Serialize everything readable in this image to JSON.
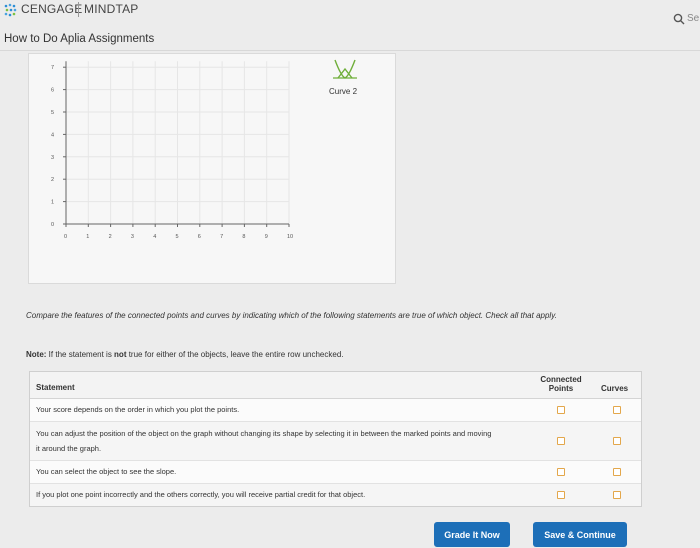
{
  "header": {
    "brand": "CENGAGE",
    "product": "MINDTAP",
    "search_text": "Se"
  },
  "page": {
    "title": "How to Do Aplia Assignments"
  },
  "graph": {
    "y_ticks": [
      "0",
      "1",
      "2",
      "3",
      "4",
      "5",
      "6",
      "7"
    ],
    "x_ticks": [
      "0",
      "1",
      "2",
      "3",
      "4",
      "5",
      "6",
      "7",
      "8",
      "9",
      "10"
    ],
    "curve_label": "Curve 2"
  },
  "instructions": {
    "text": "Compare the features of the connected points and curves by indicating which of the following statements are true of which object. Check all that apply.",
    "note_label": "Note:",
    "note_pre": " If the statement is ",
    "note_not": "not",
    "note_post": " true for either of the objects, leave the entire row unchecked."
  },
  "table": {
    "header_statement": "Statement",
    "header_connected": "Connected Points",
    "header_curves": "Curves",
    "rows": [
      {
        "statement": "Your score depends on the order in which you plot the points."
      },
      {
        "statement": "You can adjust the position of the object on the graph without changing its shape by selecting it in between the marked points and moving it around the graph."
      },
      {
        "statement": "You can select the object to see the slope."
      },
      {
        "statement": "If you plot one point incorrectly and the others correctly, you will receive partial credit for that object."
      }
    ]
  },
  "buttons": {
    "grade": "Grade It Now",
    "save": "Save & Continue"
  },
  "colors": {
    "accent": "#1d6fb8",
    "checkbox_border": "#e3a74b"
  }
}
